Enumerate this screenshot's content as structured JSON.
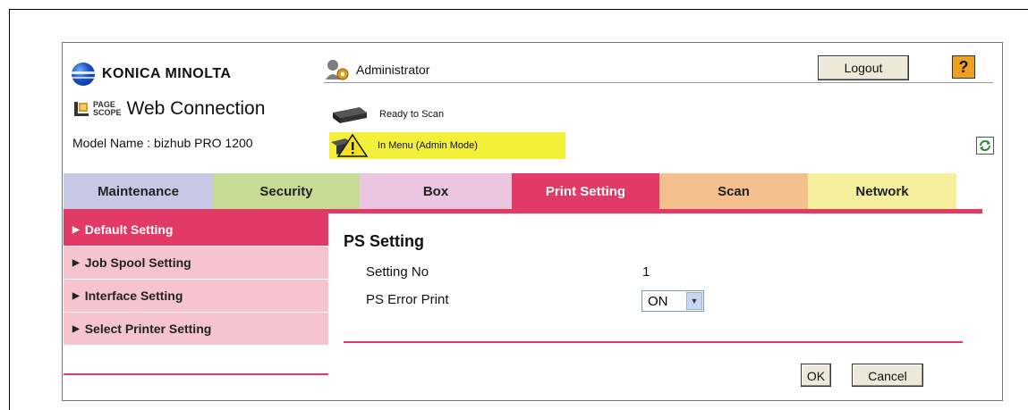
{
  "header": {
    "brand": "KONICA MINOLTA",
    "pagescope_word_top": "PAGE",
    "pagescope_word_bottom": "SCOPE",
    "app_name": "Web Connection",
    "model_name": "Model Name : bizhub PRO 1200",
    "user_role": "Administrator",
    "logout_label": "Logout",
    "help_label": "?",
    "status_scanner": "Ready to Scan",
    "status_warning": "In Menu (Admin Mode)"
  },
  "tabs": [
    {
      "label": "Maintenance",
      "color": "#c8c8e6",
      "active": false
    },
    {
      "label": "Security",
      "color": "#c6dc94",
      "active": false
    },
    {
      "label": "Box",
      "color": "#eac6e0",
      "active": false
    },
    {
      "label": "Print Setting",
      "color": "#e23a66",
      "active": true
    },
    {
      "label": "Scan",
      "color": "#f4c08e",
      "active": false
    },
    {
      "label": "Network",
      "color": "#f6f09c",
      "active": false
    }
  ],
  "sidebar": {
    "items": [
      {
        "label": "Default Setting",
        "active": true
      },
      {
        "label": "Job Spool Setting",
        "active": false
      },
      {
        "label": "Interface Setting",
        "active": false
      },
      {
        "label": "Select Printer Setting",
        "active": false
      }
    ]
  },
  "main": {
    "title": "PS Setting",
    "rows": [
      {
        "label": "Setting No",
        "value": "1"
      },
      {
        "label": "PS Error Print",
        "value": "ON"
      }
    ],
    "ok_label": "OK",
    "cancel_label": "Cancel"
  },
  "colors": {
    "accent": "#e23a66",
    "sidebar_inactive": "#f5c4cf",
    "warning_bar": "#f3f03a"
  },
  "icons": {
    "admin": "admin-gear-icon",
    "scanner": "scanner-icon",
    "warning": "warning-icon",
    "refresh": "refresh-icon",
    "help": "help-icon",
    "brand": "globe-logo-icon"
  }
}
